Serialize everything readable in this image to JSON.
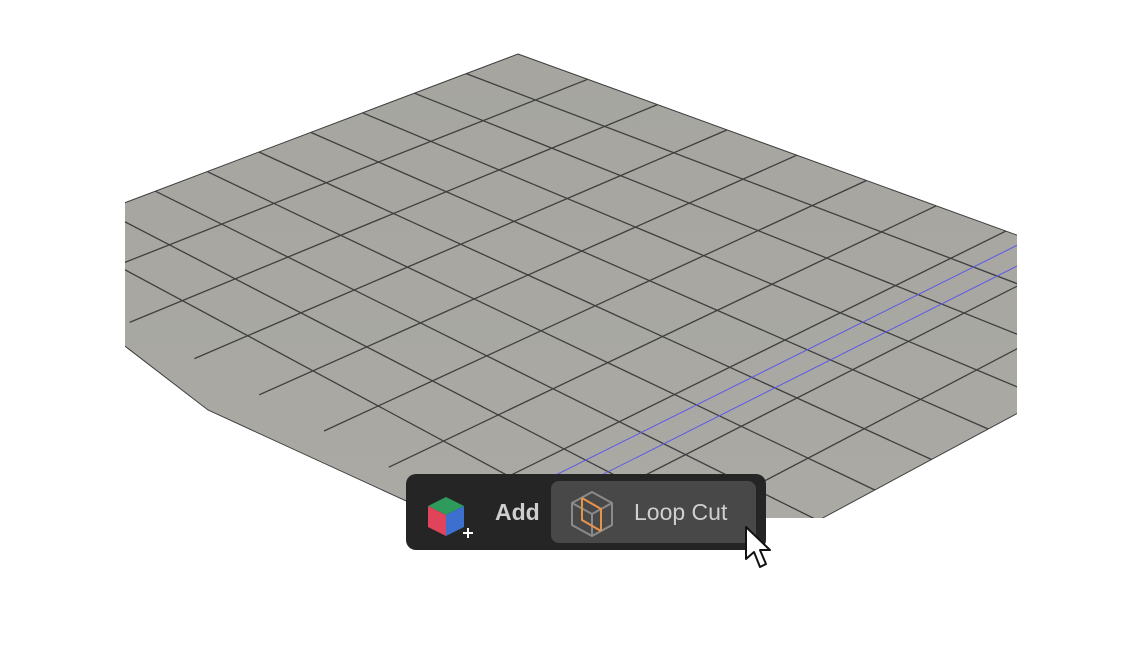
{
  "viewport": {
    "mesh_color": "#a9a8a3",
    "edge_color": "#3f3f3f",
    "loop_cut_preview_color": "#5a5ae6"
  },
  "toolbar": {
    "add": {
      "icon": "add-cube-icon",
      "label": "Add"
    },
    "loop_cut": {
      "icon": "loop-cut-icon",
      "label": "Loop Cut",
      "active": true
    }
  },
  "cursor": {
    "icon": "arrow-cursor-icon"
  }
}
